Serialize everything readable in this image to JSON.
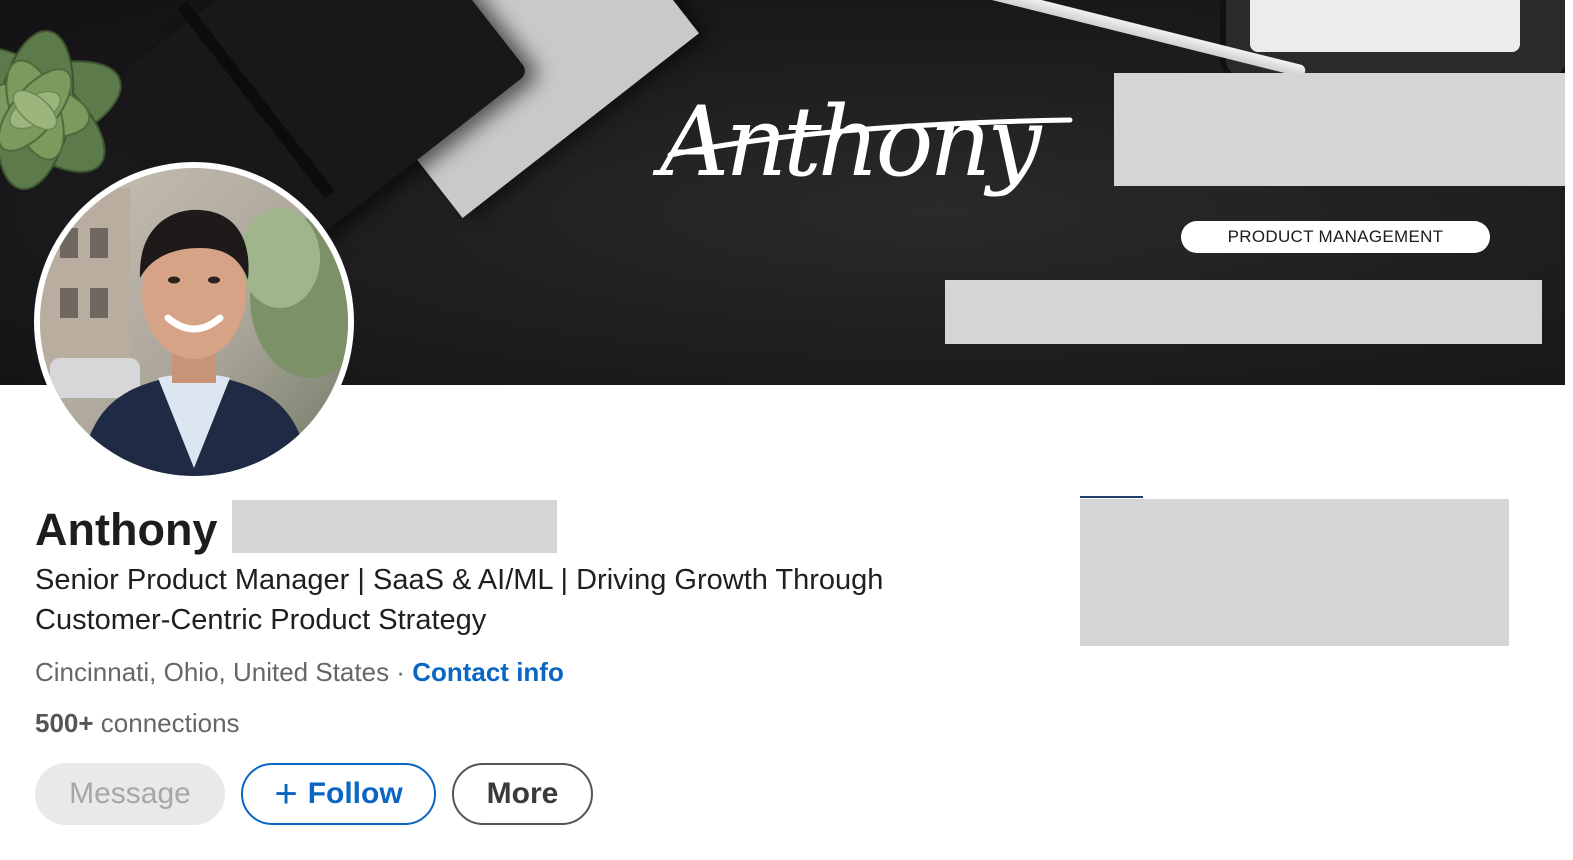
{
  "banner": {
    "script_name": "Anthony",
    "pill_label": "PRODUCT MANAGEMENT"
  },
  "profile": {
    "first_name": "Anthony",
    "headline": "Senior Product Manager | SaaS & AI/ML | Driving Growth Through Customer-Centric Product Strategy",
    "location": "Cincinnati, Ohio, United States",
    "separator": " · ",
    "contact_label": "Contact info",
    "connections_count": "500+",
    "connections_label": " connections"
  },
  "actions": {
    "message_label": "Message",
    "follow_plus": "+",
    "follow_label": "Follow",
    "more_label": "More"
  },
  "colors": {
    "link_blue": "#0a66c2",
    "redaction_gray": "#d4d5d7",
    "banner_dark": "#1c1c1e"
  }
}
